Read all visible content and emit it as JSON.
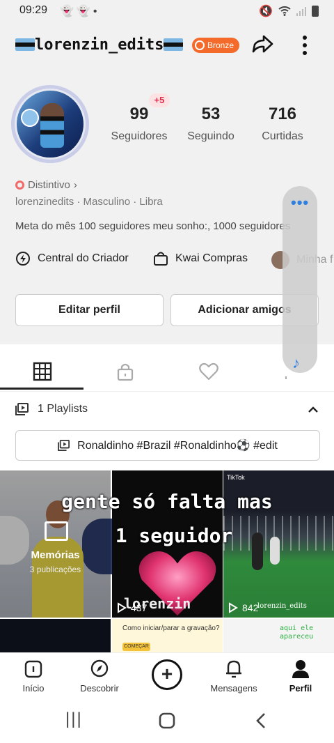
{
  "status": {
    "time": "09:29",
    "left_icons": [
      "snapchat-icon",
      "snapchat-icon",
      "dot"
    ],
    "right_icons": [
      "mute-icon",
      "wifi-icon",
      "signal-icon",
      "battery-icon"
    ]
  },
  "header": {
    "username": "lorenzin_edits",
    "badge_label": "Bronze"
  },
  "stats": {
    "new_followers_badge": "+5",
    "followers": {
      "count": "99",
      "label": "Seguidores"
    },
    "following": {
      "count": "53",
      "label": "Seguindo"
    },
    "likes": {
      "count": "716",
      "label": "Curtidas"
    }
  },
  "profile": {
    "distintivo": "Distintivo",
    "distintivo_chevron": "›",
    "meta": "lorenzinedits · Masculino · Libra",
    "bio": "Meta do mês 100 seguidores meu sonho:, 1000 seguidores"
  },
  "shortcuts": {
    "creator_center": "Central do Criador",
    "kwai_shop": "Kwai Compras",
    "third": "Minha f"
  },
  "buttons": {
    "edit_profile": "Editar perfil",
    "add_friends": "Adicionar amigos"
  },
  "overlay": {
    "dots": "•••",
    "music": "♪"
  },
  "tabs": [
    "grid-icon",
    "lock-icon",
    "heart-icon",
    "music-icon"
  ],
  "playlists": {
    "label": "1 Playlists",
    "chevron": "^",
    "item": "Ronaldinho #Brazil #Ronaldinho⚽️ #edit"
  },
  "grid": {
    "memories_title": "Memórias",
    "memories_sub": "3 publicações",
    "overlay_line1": "gente só falta mas",
    "overlay_line2": "1 seguidor",
    "cell2_text": "lorenzin",
    "cell2_views": "437",
    "cell3_tag": "TikTok",
    "cell3_sig": "lorenzin_edits",
    "cell3_views": "842",
    "row2_c2_text": "Como iniciar/parar a gravação?",
    "row2_c2_button": "COMEÇAR",
    "row2_c3_text": "aqui ele\napareceu"
  },
  "nav": {
    "home": "Início",
    "discover": "Descobrir",
    "create": "+",
    "messages": "Mensagens",
    "profile": "Perfil"
  },
  "system_nav": {
    "recents": "|||",
    "home": "○",
    "back": "‹"
  }
}
